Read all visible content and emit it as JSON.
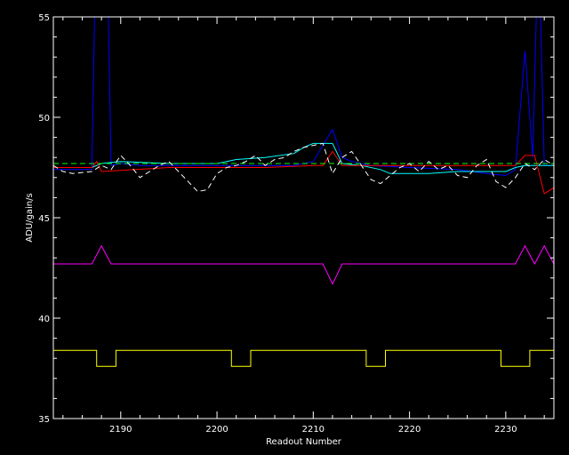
{
  "chart_data": {
    "type": "line",
    "title": "",
    "xlabel": "Readout Number",
    "ylabel": "ADU/gain/s",
    "xlim": [
      2183,
      2235
    ],
    "ylim": [
      35,
      55
    ],
    "xticks": [
      2190,
      2200,
      2210,
      2220,
      2230
    ],
    "yticks": [
      35,
      40,
      45,
      50,
      55
    ],
    "grid": false,
    "background": "#000000",
    "axis_color": "#ffffff",
    "series": [
      {
        "color": "#0000ff",
        "style": "solid",
        "points": [
          [
            2183,
            47.4
          ],
          [
            2186,
            47.4
          ],
          [
            2187,
            47.4
          ],
          [
            2187.3,
            55.5
          ],
          [
            2188.7,
            55.5
          ],
          [
            2189,
            47.6
          ],
          [
            2190,
            47.7
          ],
          [
            2192,
            47.6
          ],
          [
            2195,
            47.6
          ],
          [
            2200,
            47.6
          ],
          [
            2203,
            47.6
          ],
          [
            2205,
            47.6
          ],
          [
            2208,
            47.6
          ],
          [
            2210,
            47.8
          ],
          [
            2211,
            48.6
          ],
          [
            2212,
            49.4
          ],
          [
            2213,
            48.0
          ],
          [
            2214,
            47.8
          ],
          [
            2216,
            47.6
          ],
          [
            2220,
            47.5
          ],
          [
            2225,
            47.4
          ],
          [
            2228,
            47.2
          ],
          [
            2230,
            47.1
          ],
          [
            2231,
            47.4
          ],
          [
            2232,
            53.3
          ],
          [
            2232.8,
            48.0
          ],
          [
            2233.2,
            55.5
          ],
          [
            2233.6,
            55.5
          ],
          [
            2234,
            47.6
          ],
          [
            2235,
            47.6
          ]
        ]
      },
      {
        "color": "#00ffff",
        "style": "solid",
        "points": [
          [
            2183,
            47.5
          ],
          [
            2187,
            47.5
          ],
          [
            2188,
            47.7
          ],
          [
            2190,
            47.8
          ],
          [
            2195,
            47.7
          ],
          [
            2200,
            47.7
          ],
          [
            2202,
            47.9
          ],
          [
            2205,
            48.0
          ],
          [
            2208,
            48.2
          ],
          [
            2209,
            48.5
          ],
          [
            2210,
            48.7
          ],
          [
            2212,
            48.7
          ],
          [
            2213,
            47.7
          ],
          [
            2215,
            47.6
          ],
          [
            2217,
            47.4
          ],
          [
            2218,
            47.2
          ],
          [
            2222,
            47.2
          ],
          [
            2225,
            47.3
          ],
          [
            2230,
            47.3
          ],
          [
            2231,
            47.5
          ],
          [
            2232,
            47.6
          ],
          [
            2235,
            47.6
          ]
        ]
      },
      {
        "color": "#ff0000",
        "style": "solid",
        "points": [
          [
            2183,
            47.5
          ],
          [
            2187,
            47.5
          ],
          [
            2187.5,
            47.8
          ],
          [
            2188,
            47.3
          ],
          [
            2195,
            47.5
          ],
          [
            2200,
            47.5
          ],
          [
            2205,
            47.5
          ],
          [
            2210,
            47.6
          ],
          [
            2211,
            47.6
          ],
          [
            2212,
            48.3
          ],
          [
            2213,
            47.6
          ],
          [
            2215,
            47.6
          ],
          [
            2220,
            47.6
          ],
          [
            2225,
            47.6
          ],
          [
            2231,
            47.6
          ],
          [
            2232,
            48.1
          ],
          [
            2233,
            48.1
          ],
          [
            2234,
            46.2
          ],
          [
            2235,
            46.5
          ]
        ]
      },
      {
        "color": "#00ff00",
        "style": "dashed",
        "points": [
          [
            2183,
            47.7
          ],
          [
            2235,
            47.7
          ]
        ]
      },
      {
        "color": "#ffffff",
        "style": "dashed",
        "points": [
          [
            2183,
            47.6
          ],
          [
            2184,
            47.3
          ],
          [
            2185,
            47.2
          ],
          [
            2187,
            47.3
          ],
          [
            2188,
            47.6
          ],
          [
            2189,
            47.4
          ],
          [
            2190,
            48.1
          ],
          [
            2191,
            47.6
          ],
          [
            2192,
            47.0
          ],
          [
            2193,
            47.3
          ],
          [
            2194,
            47.6
          ],
          [
            2195,
            47.8
          ],
          [
            2196,
            47.3
          ],
          [
            2197,
            46.8
          ],
          [
            2198,
            46.3
          ],
          [
            2199,
            46.4
          ],
          [
            2200,
            47.2
          ],
          [
            2201,
            47.5
          ],
          [
            2202,
            47.6
          ],
          [
            2203,
            47.8
          ],
          [
            2204,
            48.1
          ],
          [
            2205,
            47.6
          ],
          [
            2206,
            47.9
          ],
          [
            2207,
            48.0
          ],
          [
            2208,
            48.3
          ],
          [
            2209,
            48.5
          ],
          [
            2210,
            48.6
          ],
          [
            2211,
            48.7
          ],
          [
            2212,
            47.2
          ],
          [
            2213,
            48.0
          ],
          [
            2214,
            48.3
          ],
          [
            2215,
            47.6
          ],
          [
            2216,
            46.9
          ],
          [
            2217,
            46.7
          ],
          [
            2218,
            47.1
          ],
          [
            2219,
            47.5
          ],
          [
            2220,
            47.7
          ],
          [
            2221,
            47.3
          ],
          [
            2222,
            47.8
          ],
          [
            2223,
            47.4
          ],
          [
            2224,
            47.6
          ],
          [
            2225,
            47.1
          ],
          [
            2226,
            47.0
          ],
          [
            2227,
            47.6
          ],
          [
            2228,
            47.9
          ],
          [
            2229,
            46.8
          ],
          [
            2230,
            46.5
          ],
          [
            2231,
            47.0
          ],
          [
            2232,
            47.7
          ],
          [
            2233,
            47.4
          ],
          [
            2234,
            47.9
          ],
          [
            2235,
            47.6
          ]
        ]
      },
      {
        "color": "#ff00ff",
        "style": "solid",
        "points": [
          [
            2183,
            42.7
          ],
          [
            2187,
            42.7
          ],
          [
            2188,
            43.6
          ],
          [
            2189,
            42.7
          ],
          [
            2211,
            42.7
          ],
          [
            2212,
            41.7
          ],
          [
            2213,
            42.7
          ],
          [
            2231,
            42.7
          ],
          [
            2232,
            43.6
          ],
          [
            2233,
            42.7
          ],
          [
            2234,
            43.6
          ],
          [
            2235,
            42.7
          ]
        ]
      },
      {
        "color": "#ffff00",
        "style": "steps",
        "points": [
          [
            2183,
            38.4
          ],
          [
            2187.5,
            38.4
          ],
          [
            2187.5,
            37.6
          ],
          [
            2189.5,
            37.6
          ],
          [
            2189.5,
            38.4
          ],
          [
            2201.5,
            38.4
          ],
          [
            2201.5,
            37.6
          ],
          [
            2203.5,
            37.6
          ],
          [
            2203.5,
            38.4
          ],
          [
            2215.5,
            38.4
          ],
          [
            2215.5,
            37.6
          ],
          [
            2217.5,
            37.6
          ],
          [
            2217.5,
            38.4
          ],
          [
            2229.5,
            38.4
          ],
          [
            2229.5,
            37.6
          ],
          [
            2232.5,
            37.6
          ],
          [
            2232.5,
            38.4
          ],
          [
            2235,
            38.4
          ]
        ]
      }
    ]
  }
}
